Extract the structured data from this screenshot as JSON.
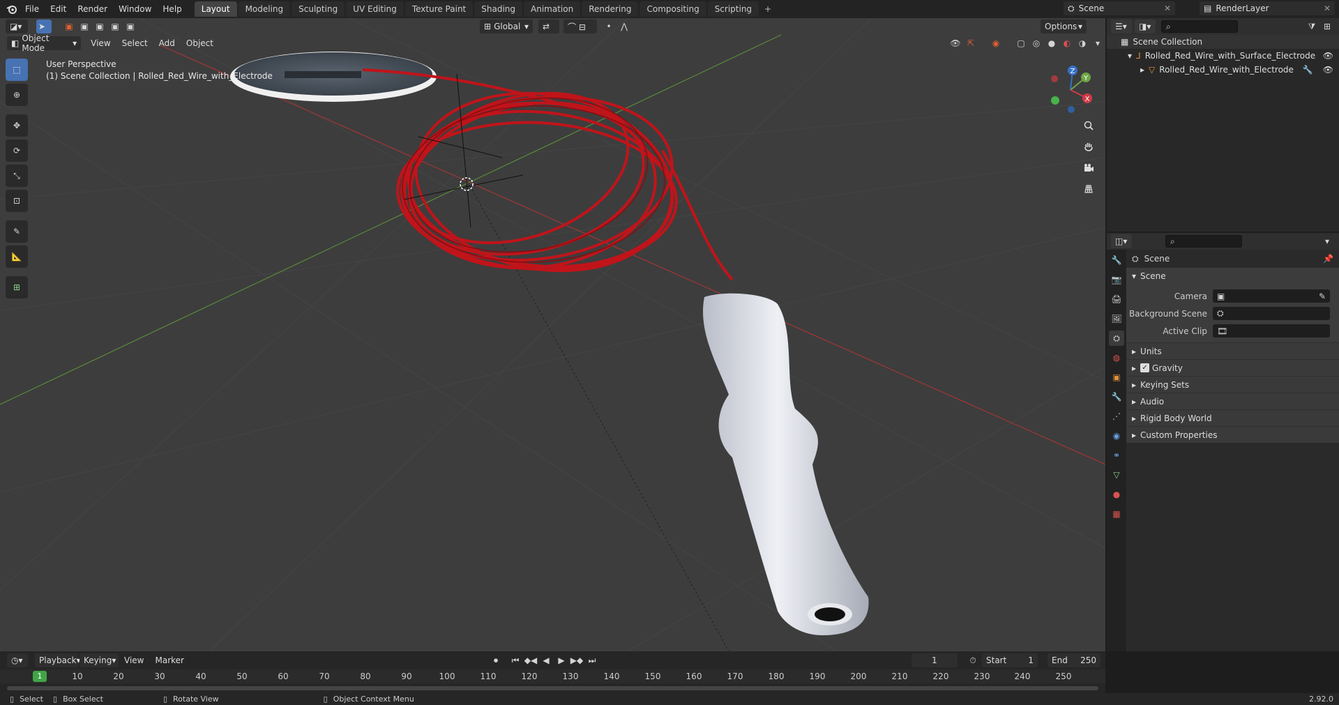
{
  "menus": {
    "file": "File",
    "edit": "Edit",
    "render": "Render",
    "window": "Window",
    "help": "Help"
  },
  "workspaces": [
    "Layout",
    "Modeling",
    "Sculpting",
    "UV Editing",
    "Texture Paint",
    "Shading",
    "Animation",
    "Rendering",
    "Compositing",
    "Scripting"
  ],
  "scene_name": "Scene",
  "render_layer": "RenderLayer",
  "viewport": {
    "mode": "Object Mode",
    "menus": {
      "view": "View",
      "select": "Select",
      "add": "Add",
      "object": "Object"
    },
    "transform_orientation": "Global",
    "options": "Options",
    "perspective": "User Perspective",
    "context": "(1) Scene Collection | Rolled_Red_Wire_with_Electrode"
  },
  "gizmo": {
    "z": "Z",
    "y": "Y",
    "x": "X"
  },
  "outliner": {
    "root": "Scene Collection",
    "items": [
      "Rolled_Red_Wire_with_Surface_Electrode",
      "Rolled_Red_Wire_with_Electrode"
    ]
  },
  "properties": {
    "title": "Scene",
    "panel": "Scene",
    "fields": [
      {
        "label": "Camera"
      },
      {
        "label": "Background Scene"
      },
      {
        "label": "Active Clip"
      }
    ],
    "subpanels": [
      "Units",
      "Gravity",
      "Keying Sets",
      "Audio",
      "Rigid Body World",
      "Custom Properties"
    ]
  },
  "timeline": {
    "menus": {
      "playback": "Playback",
      "keying": "Keying",
      "view": "View",
      "marker": "Marker"
    },
    "current_frame": "1",
    "start_label": "Start",
    "start": "1",
    "end_label": "End",
    "end": "250",
    "ticks": [
      "10",
      "20",
      "30",
      "40",
      "50",
      "60",
      "70",
      "80",
      "90",
      "100",
      "110",
      "120",
      "130",
      "140",
      "150",
      "160",
      "170",
      "180",
      "190",
      "200",
      "210",
      "220",
      "230",
      "240",
      "250"
    ],
    "cursor_frame": "1"
  },
  "status": {
    "select": "Select",
    "box_select": "Box Select",
    "rotate_view": "Rotate View",
    "context_menu": "Object Context Menu",
    "version": "2.92.0"
  },
  "colors": {
    "accent": "#4772b3",
    "wire": "#c0141a",
    "handle": "#d9dce3",
    "frame_green": "#41a446"
  }
}
